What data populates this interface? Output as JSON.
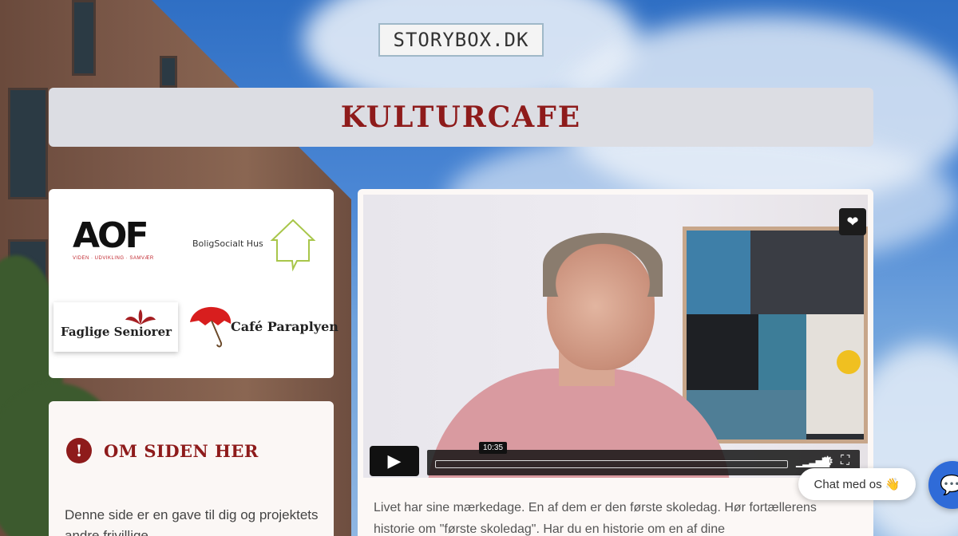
{
  "site": {
    "logo_text": "STORYBOX.DK"
  },
  "page": {
    "title": "KULTURCAFE"
  },
  "partners": {
    "aof": {
      "name": "AOF",
      "tagline": "VIDEN · UDVIKLING · SAMVÆR"
    },
    "boligsocialt": {
      "name": "BoligSocialt Hus"
    },
    "faglige": {
      "name": "Faglige Seniorer"
    },
    "cafe": {
      "name": "Café Paraplyen"
    }
  },
  "about": {
    "icon": "info-icon",
    "title": "OM SIDEN HER",
    "text": "Denne side er en gave til dig og projektets andre frivillige"
  },
  "video": {
    "time_label": "10:35",
    "play_icon": "play-icon",
    "favorite_icon": "heart-icon",
    "description": "Livet har sine mærkedage. En af dem er den første skoledag. Hør fortællerens historie om \"første skoledag\". Har du en historie om en af dine"
  },
  "chat": {
    "label": "Chat med os 👋",
    "launcher_icon": "chat-icon"
  },
  "colors": {
    "accent": "#8e1b1b",
    "title_bar_bg": "#dcdde3",
    "chat_blue": "#2f6bd8"
  }
}
